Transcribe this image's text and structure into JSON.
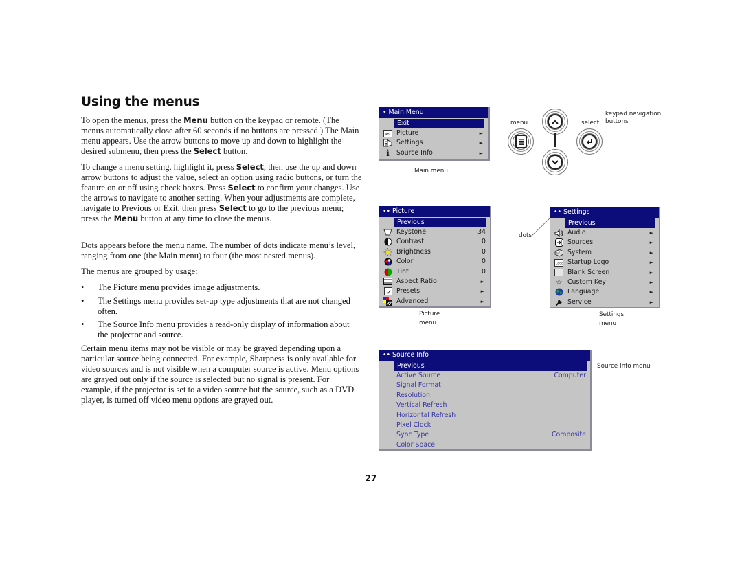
{
  "title": "Using the menus",
  "paragraphs": {
    "p1": [
      {
        "t": "To open the menus, press the "
      },
      {
        "b": "Menu"
      },
      {
        "t": " button on the keypad or remote. (The menus automatically close after 60 seconds if no buttons are pressed.) The Main menu appears. Use the arrow buttons to move up and down to highlight the desired submenu, then press the "
      },
      {
        "b": "Select"
      },
      {
        "t": " button."
      }
    ],
    "p2": [
      {
        "t": "To change a menu setting, highlight it, press "
      },
      {
        "b": "Select"
      },
      {
        "t": ", then use the up and down arrow buttons to adjust the value, select an option using radio buttons, or turn the feature on or off using check boxes. Press "
      },
      {
        "b": "Select"
      },
      {
        "t": " to confirm your changes. Use the arrows to navigate to another setting. When your adjustments are complete, navigate to Previous or Exit, then press "
      },
      {
        "b": "Select"
      },
      {
        "t": " to go to the previous menu; press the "
      },
      {
        "b": "Menu"
      },
      {
        "t": " button at any time to close the menus."
      }
    ],
    "p3": "Dots appears before the menu name. The number of dots indicate menu’s level, ranging from one (the Main menu) to four (the most nested menus).",
    "p4": "The menus are grouped by usage:",
    "bullets": [
      "The Picture menu provides image adjustments.",
      "The Settings menu provides set-up type adjustments that are not changed often.",
      "The Source Info menu provides a read-only display of information about the projector and source."
    ],
    "p5": "Certain menu items may not be visible or may be grayed depending upon a particular source being connected. For example, Sharpness is only available for video sources and is not visible when a computer source is active. Menu options are grayed out only if the source is selected but no signal is present. For example, if the projector is set to a video source but the source, such as a DVD player, is turned off video menu options are grayed out."
  },
  "bullet_glyph": "•",
  "main_menu": {
    "header": "• Main Menu",
    "highlight": "Exit",
    "items": [
      {
        "icon": "picture-icon",
        "label": "Picture",
        "arrow": "►"
      },
      {
        "icon": "settings-icon",
        "label": "Settings",
        "arrow": "►"
      },
      {
        "icon": "info-icon",
        "label": "Source Info",
        "arrow": "►"
      }
    ],
    "caption": "Main menu"
  },
  "keypad": {
    "menu_label": "menu",
    "select_label": "select",
    "caption_line1": "keypad navigation",
    "caption_line2": "buttons",
    "up_glyph": "^",
    "down_glyph": "v",
    "select_glyph": "↲",
    "menu_glyph": "≣"
  },
  "picture_menu": {
    "header": "•• Picture",
    "highlight": "Previous",
    "items": [
      {
        "icon": "keystone-icon",
        "label": "Keystone",
        "value": "34"
      },
      {
        "icon": "contrast-icon",
        "label": "Contrast",
        "value": "0"
      },
      {
        "icon": "brightness-icon",
        "label": "Brightness",
        "value": "0"
      },
      {
        "icon": "color-icon",
        "label": "Color",
        "value": "0"
      },
      {
        "icon": "tint-icon",
        "label": "Tint",
        "value": "0"
      },
      {
        "icon": "aspect-ratio-icon",
        "label": "Aspect Ratio",
        "value": "►"
      },
      {
        "icon": "presets-icon",
        "label": "Presets",
        "value": "►"
      },
      {
        "icon": "advanced-icon",
        "label": "Advanced",
        "value": "►"
      }
    ],
    "caption_line1": "Picture",
    "caption_line2": "menu"
  },
  "settings_menu": {
    "header": "•• Settings",
    "highlight": "Previous",
    "items": [
      {
        "icon": "audio-icon",
        "label": "Audio",
        "value": "►"
      },
      {
        "icon": "sources-icon",
        "label": "Sources",
        "value": "►"
      },
      {
        "icon": "system-icon",
        "label": "System",
        "value": "►"
      },
      {
        "icon": "startup-logo-icon",
        "label": "Startup Logo",
        "value": "►"
      },
      {
        "icon": "blank-screen-icon",
        "label": "Blank Screen",
        "value": "►"
      },
      {
        "icon": "custom-key-icon",
        "label": "Custom Key",
        "value": "►"
      },
      {
        "icon": "language-icon",
        "label": "Language",
        "value": "►"
      },
      {
        "icon": "service-icon",
        "label": "Service",
        "value": "►"
      }
    ],
    "caption_line1": "Settings",
    "caption_line2": "menu",
    "dots_label": "dots"
  },
  "source_info_menu": {
    "header": "•• Source Info",
    "highlight": "Previous",
    "items": [
      {
        "label": "Active Source",
        "value": "Computer"
      },
      {
        "label": "Signal Format",
        "value": ""
      },
      {
        "label": "Resolution",
        "value": ""
      },
      {
        "label": "Vertical Refresh",
        "value": ""
      },
      {
        "label": "Horizontal Refresh",
        "value": ""
      },
      {
        "label": "Pixel Clock",
        "value": ""
      },
      {
        "label": "Sync Type",
        "value": "Composite"
      },
      {
        "label": "Color Space",
        "value": ""
      }
    ],
    "caption": "Source Info menu"
  },
  "page_number": "27",
  "colors": {
    "menu_header_bg": "#0c0c7a",
    "menu_bg": "#c5c5c5",
    "source_info_text": "#3838a4"
  }
}
